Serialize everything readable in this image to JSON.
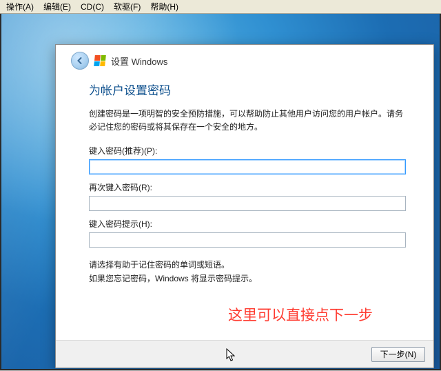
{
  "menu": {
    "action": "操作(A)",
    "edit": "编辑(E)",
    "cd": "CD(C)",
    "floppy": "软驱(F)",
    "help": "帮助(H)"
  },
  "setup": {
    "header_title": "设置 Windows",
    "page_title": "为帐户设置密码",
    "description": "创建密码是一项明智的安全预防措施，可以帮助防止其他用户访问您的用户帐户。请务必记住您的密码或将其保存在一个安全的地方。",
    "label_password": "键入密码(推荐)(P):",
    "label_confirm": "再次键入密码(R):",
    "label_hint": "键入密码提示(H):",
    "value_password": "",
    "value_confirm": "",
    "value_hint": "",
    "hint_line1": "请选择有助于记住密码的单词或短语。",
    "hint_line2": "如果您忘记密码，Windows 将显示密码提示。",
    "next_label": "下一步(N)"
  },
  "annotation": "这里可以直接点下一步"
}
